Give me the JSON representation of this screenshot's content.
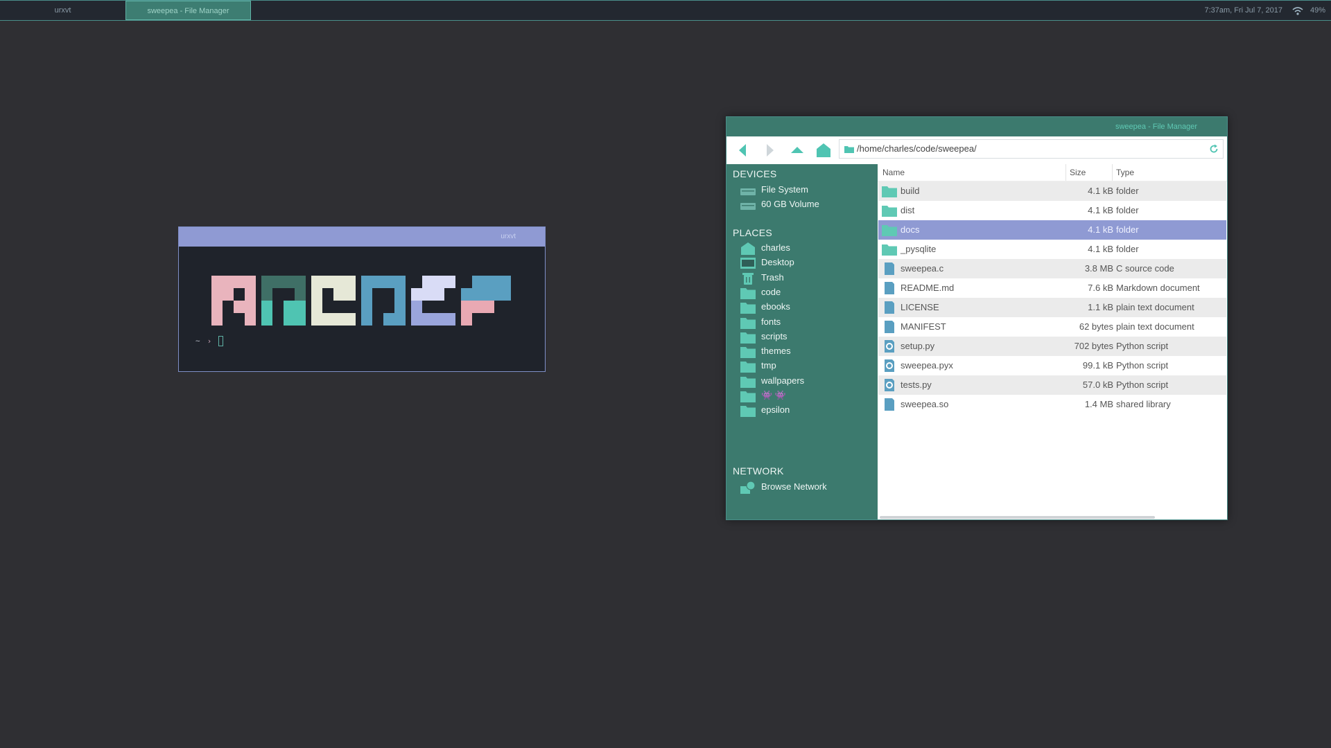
{
  "colors": {
    "desktop": "#2f2f33",
    "accent_teal": "#3c7a6e",
    "accent_teal_light": "#5fc9b4",
    "selection": "#8f9ad3",
    "folder_icon": "#5fc9b4",
    "file_icon": "#5a9fc1"
  },
  "panel": {
    "tasks": [
      {
        "label": "urxvt"
      },
      {
        "label": "sweepea - File Manager"
      }
    ],
    "clock": "7:37am, Fri Jul 7, 2017",
    "battery": "49%"
  },
  "terminal": {
    "title": "urxvt",
    "prompt_tilde": "~",
    "prompt_arrow": "›",
    "logo_colors": [
      "#e9b4bd",
      "#3f6f66",
      "#4fc4b2",
      "#e6e8d7",
      "#5a9fc1",
      "#d9dcf6",
      "#9aa5dc",
      "#e9a9b3"
    ]
  },
  "file_manager": {
    "title": "sweepea - File Manager",
    "path": "/home/charles/code/sweepea/",
    "sidebar": {
      "devices_heading": "DEVICES",
      "devices": [
        {
          "label": "File System",
          "icon": "drive-icon"
        },
        {
          "label": "60 GB Volume",
          "icon": "drive-icon"
        }
      ],
      "places_heading": "PLACES",
      "places": [
        {
          "label": "charles",
          "icon": "home-icon"
        },
        {
          "label": "Desktop",
          "icon": "desktop-icon"
        },
        {
          "label": "Trash",
          "icon": "trash-icon"
        },
        {
          "label": "code",
          "icon": "folder-icon"
        },
        {
          "label": "ebooks",
          "icon": "folder-icon"
        },
        {
          "label": "fonts",
          "icon": "folder-icon"
        },
        {
          "label": "scripts",
          "icon": "folder-icon"
        },
        {
          "label": "themes",
          "icon": "folder-icon"
        },
        {
          "label": "tmp",
          "icon": "folder-icon"
        },
        {
          "label": "wallpapers",
          "icon": "folder-icon"
        },
        {
          "label": "👾 👾",
          "icon": "folder-icon"
        },
        {
          "label": "epsilon",
          "icon": "folder-icon"
        }
      ],
      "network_heading": "NETWORK",
      "network": [
        {
          "label": "Browse Network",
          "icon": "network-icon"
        }
      ]
    },
    "columns": {
      "name": "Name",
      "size": "Size",
      "type": "Type"
    },
    "files": [
      {
        "name": "build",
        "size": "4.1 kB",
        "type": "folder",
        "icon": "folder-icon"
      },
      {
        "name": "dist",
        "size": "4.1 kB",
        "type": "folder",
        "icon": "folder-icon"
      },
      {
        "name": "docs",
        "size": "4.1 kB",
        "type": "folder",
        "icon": "folder-icon",
        "selected": true
      },
      {
        "name": "_pysqlite",
        "size": "4.1 kB",
        "type": "folder",
        "icon": "folder-icon"
      },
      {
        "name": "sweepea.c",
        "size": "3.8 MB",
        "type": "C source code",
        "icon": "file-icon"
      },
      {
        "name": "README.md",
        "size": "7.6 kB",
        "type": "Markdown document",
        "icon": "file-icon"
      },
      {
        "name": "LICENSE",
        "size": "1.1 kB",
        "type": "plain text document",
        "icon": "file-icon"
      },
      {
        "name": "MANIFEST",
        "size": "62 bytes",
        "type": "plain text document",
        "icon": "file-icon"
      },
      {
        "name": "setup.py",
        "size": "702 bytes",
        "type": "Python script",
        "icon": "python-icon"
      },
      {
        "name": "sweepea.pyx",
        "size": "99.1 kB",
        "type": "Python script",
        "icon": "python-icon"
      },
      {
        "name": "tests.py",
        "size": "57.0 kB",
        "type": "Python script",
        "icon": "python-icon"
      },
      {
        "name": "sweepea.so",
        "size": "1.4 MB",
        "type": "shared library",
        "icon": "file-icon"
      }
    ]
  }
}
